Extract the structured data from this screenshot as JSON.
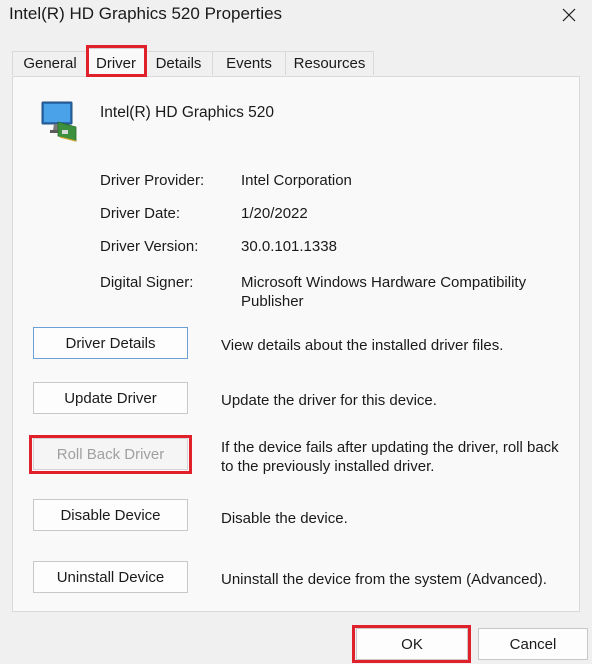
{
  "window": {
    "title": "Intel(R) HD Graphics 520 Properties"
  },
  "tabs": [
    {
      "label": "General"
    },
    {
      "label": "Driver"
    },
    {
      "label": "Details"
    },
    {
      "label": "Events"
    },
    {
      "label": "Resources"
    }
  ],
  "active_tab": "Driver",
  "device": {
    "name": "Intel(R) HD Graphics 520",
    "icon": "display-adapter-icon"
  },
  "driver_info": [
    {
      "label": "Driver Provider:",
      "value": "Intel Corporation"
    },
    {
      "label": "Driver Date:",
      "value": "1/20/2022"
    },
    {
      "label": "Driver Version:",
      "value": "30.0.101.1338"
    },
    {
      "label": "Digital Signer:",
      "value": "Microsoft Windows Hardware Compatibility Publisher"
    }
  ],
  "actions": [
    {
      "label": "Driver Details",
      "description": "View details about the installed driver files."
    },
    {
      "label": "Update Driver",
      "description": "Update the driver for this device."
    },
    {
      "label": "Roll Back Driver",
      "description": "If the device fails after updating the driver, roll back to the previously installed driver."
    },
    {
      "label": "Disable Device",
      "description": "Disable the device."
    },
    {
      "label": "Uninstall Device",
      "description": "Uninstall the device from the system (Advanced)."
    }
  ],
  "footer": {
    "ok_label": "OK",
    "cancel_label": "Cancel"
  },
  "highlight_color": "#e0202a"
}
